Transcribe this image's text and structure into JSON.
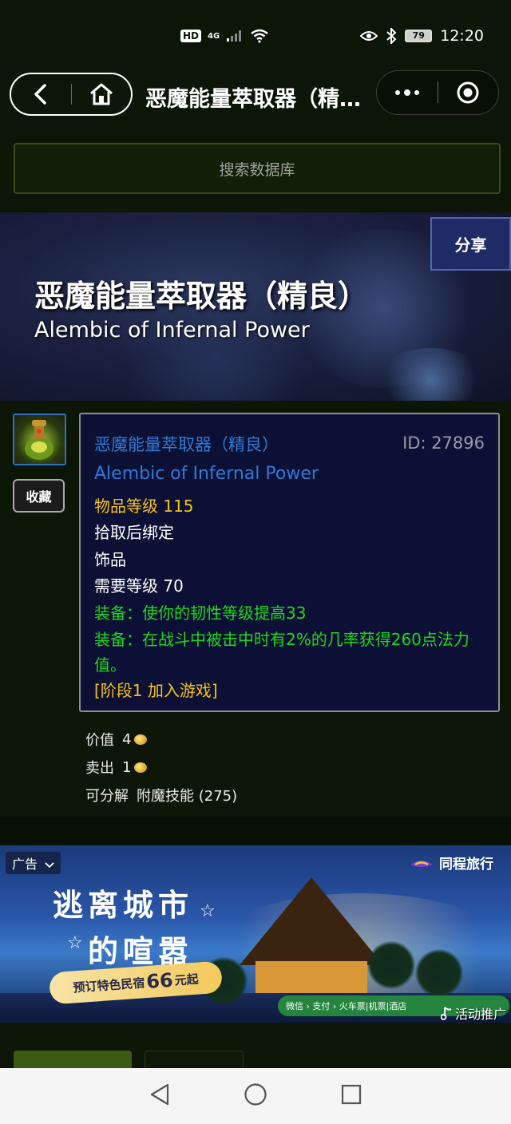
{
  "status_bar": {
    "network_badge": "HD",
    "network_type": "4G",
    "battery": "79",
    "time": "12:20"
  },
  "nav": {
    "title": "恶魔能量萃取器（精良）"
  },
  "search": {
    "placeholder": "搜索数据库"
  },
  "banner": {
    "share_label": "分享",
    "title_cn": "恶魔能量萃取器（精良）",
    "title_en": "Alembic of Infernal Power"
  },
  "item": {
    "favorite_label": "收藏",
    "name_cn": "恶魔能量萃取器（精良）",
    "id_text": "ID: 27896",
    "name_en": "Alembic of Infernal Power",
    "item_level": "物品等级 115",
    "bind": "拾取后绑定",
    "slot": "饰品",
    "required_level": "需要等级 70",
    "effect1": "装备：使你的韧性等级提高33",
    "effect2": "装备：在战斗中被击中时有2%的几率获得260点法力值。",
    "phase": "[阶段1 加入游戏]"
  },
  "prices": {
    "value_label": "价值",
    "value_amount": "4",
    "sell_label": "卖出",
    "sell_amount": "1",
    "disenchant_label": "可分解",
    "disenchant_value": "附魔技能 (275)"
  },
  "ad": {
    "label": "广告",
    "brand": "同程旅行",
    "headline1": "逃离城市",
    "headline2": "的喧嚣",
    "promo_prefix": "预订特色民宿",
    "promo_number": "66",
    "promo_suffix": "元起",
    "pay_bar": "微信 › 支付 › 火车票|机票|酒店",
    "activity": "活动推广"
  },
  "colors": {
    "background": "#0b1607",
    "tooltip_bg": "#0c1034",
    "item_name_blue": "#2f7ad8",
    "yellow": "#f4c21a",
    "green": "#1fd81f",
    "share_bg": "#1e2b66"
  },
  "icons": {
    "back": "back-arrow-icon",
    "home": "home-icon",
    "more": "more-dots-icon",
    "close_miniapp": "target-close-icon",
    "eye": "eye-icon",
    "bluetooth": "bluetooth-icon",
    "wifi": "wifi-icon",
    "signal": "signal-icon",
    "coin": "gold-coin-icon",
    "nav_back": "triangle-back-icon",
    "nav_home": "circle-home-icon",
    "nav_recent": "square-recent-icon"
  }
}
